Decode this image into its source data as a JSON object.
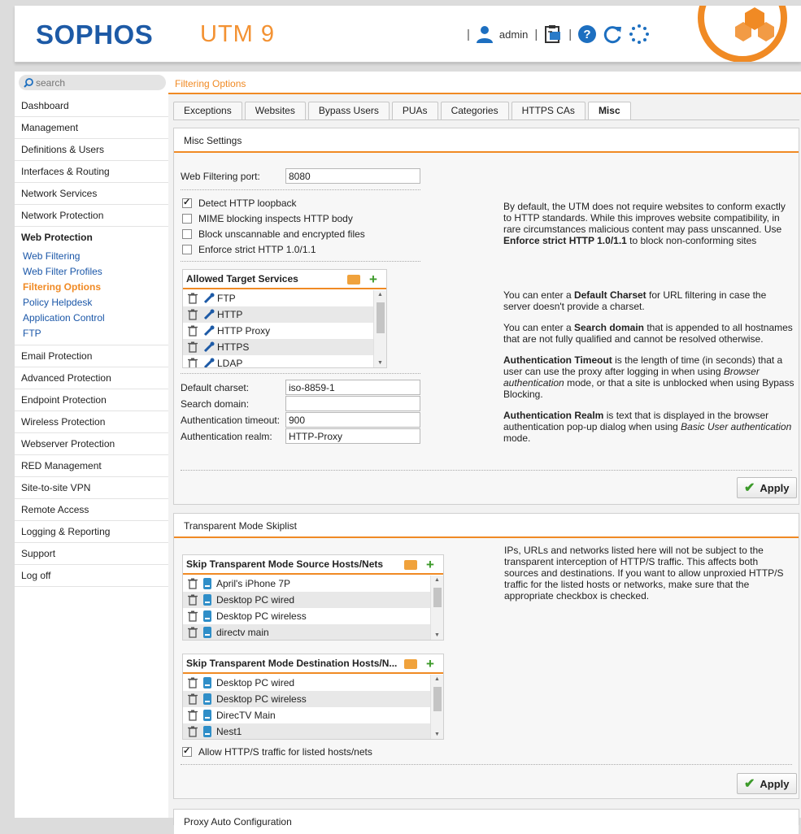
{
  "header": {
    "brand": "SOPHOS",
    "product": "UTM 9",
    "user": "admin",
    "icons": [
      "user-icon",
      "clipboard-icon",
      "help-icon",
      "reload-icon",
      "spinner-icon"
    ]
  },
  "sidebar": {
    "search_placeholder": "search",
    "items": [
      {
        "label": "Dashboard"
      },
      {
        "label": "Management"
      },
      {
        "label": "Definitions & Users"
      },
      {
        "label": "Interfaces & Routing"
      },
      {
        "label": "Network Services"
      },
      {
        "label": "Network Protection"
      },
      {
        "label": "Web Protection"
      },
      {
        "label": "Email Protection"
      },
      {
        "label": "Advanced Protection"
      },
      {
        "label": "Endpoint Protection"
      },
      {
        "label": "Wireless Protection"
      },
      {
        "label": "Webserver Protection"
      },
      {
        "label": "RED Management"
      },
      {
        "label": "Site-to-site VPN"
      },
      {
        "label": "Remote Access"
      },
      {
        "label": "Logging & Reporting"
      },
      {
        "label": "Support"
      },
      {
        "label": "Log off"
      }
    ],
    "web_protection_sub": [
      {
        "label": "Web Filtering"
      },
      {
        "label": "Web Filter Profiles"
      },
      {
        "label": "Filtering Options"
      },
      {
        "label": "Policy Helpdesk"
      },
      {
        "label": "Application Control"
      },
      {
        "label": "FTP"
      }
    ]
  },
  "main": {
    "breadcrumb": "Filtering Options",
    "tabs": [
      {
        "label": "Exceptions"
      },
      {
        "label": "Websites"
      },
      {
        "label": "Bypass Users"
      },
      {
        "label": "PUAs"
      },
      {
        "label": "Categories"
      },
      {
        "label": "HTTPS CAs"
      },
      {
        "label": "Misc"
      }
    ],
    "misc": {
      "title": "Misc Settings",
      "port_label": "Web Filtering port:",
      "port_value": "8080",
      "checkboxes": [
        {
          "label": "Detect HTTP loopback",
          "checked": true
        },
        {
          "label": "MIME blocking inspects HTTP body",
          "checked": false
        },
        {
          "label": "Block unscannable and encrypted files",
          "checked": false
        },
        {
          "label": "Enforce strict HTTP 1.0/1.1",
          "checked": false
        }
      ],
      "help_http_pre": "By default, the UTM does not require websites to conform exactly to HTTP standards. While this improves website compatibility, in rare circumstances malicious content may pass unscanned. Use ",
      "help_http_bold": "Enforce strict HTTP 1.0/1.1",
      "help_http_post": " to block non-conforming sites",
      "services_title": "Allowed Target Services",
      "services": [
        {
          "label": "FTP"
        },
        {
          "label": "HTTP"
        },
        {
          "label": "HTTP Proxy"
        },
        {
          "label": "HTTPS"
        },
        {
          "label": "LDAP"
        }
      ],
      "charset_label": "Default charset:",
      "charset_value": "iso-8859-1",
      "domain_label": "Search domain:",
      "domain_value": "",
      "timeout_label": "Authentication timeout:",
      "timeout_value": "900",
      "realm_label": "Authentication realm:",
      "realm_value": "HTTP-Proxy",
      "help_charset": {
        "a": "You can enter a ",
        "b": "Default Charset",
        "c": " for URL filtering in case the server doesn't provide a charset."
      },
      "help_domain": {
        "a": "You can enter a ",
        "b": "Search domain",
        "c": " that is appended to all hostnames that are not fully qualified and cannot be resolved otherwise."
      },
      "help_timeout": {
        "a": "",
        "b": "Authentication Timeout",
        "c": " is the length of time (in seconds) that a user can use the proxy after logging in when using ",
        "d": "Browser authentication",
        "e": " mode, or that a site is unblocked when using Bypass Blocking."
      },
      "help_realm": {
        "a": "",
        "b": "Authentication Realm",
        "c": " is text that is displayed in the browser authentication pop-up dialog when using ",
        "d": "Basic User authentication",
        "e": " mode."
      },
      "apply_label": "Apply"
    },
    "skiplist": {
      "title": "Transparent Mode Skiplist",
      "source_title": "Skip Transparent Mode Source Hosts/Nets",
      "source_items": [
        {
          "label": "April's iPhone 7P"
        },
        {
          "label": "Desktop PC wired"
        },
        {
          "label": "Desktop PC wireless"
        },
        {
          "label": "directv main"
        }
      ],
      "dest_title": "Skip Transparent Mode Destination Hosts/N...",
      "dest_items": [
        {
          "label": "Desktop PC wired"
        },
        {
          "label": "Desktop PC wireless"
        },
        {
          "label": "DirecTV Main"
        },
        {
          "label": "Nest1"
        }
      ],
      "allow_label": "Allow HTTP/S traffic for listed hosts/nets",
      "allow_checked": true,
      "help": "IPs, URLs and networks listed here will not be subject to the transparent interception of HTTP/S traffic. This affects both sources and destinations. If you want to allow unproxied HTTP/S traffic for the listed hosts or networks, make sure that the appropriate checkbox is checked.",
      "apply_label": "Apply"
    },
    "next_panel_title": "Proxy Auto Configuration"
  },
  "colors": {
    "accent": "#f08a24",
    "brand": "#1d5aa6",
    "link": "#1b57a8",
    "add": "#3c9a2a"
  }
}
